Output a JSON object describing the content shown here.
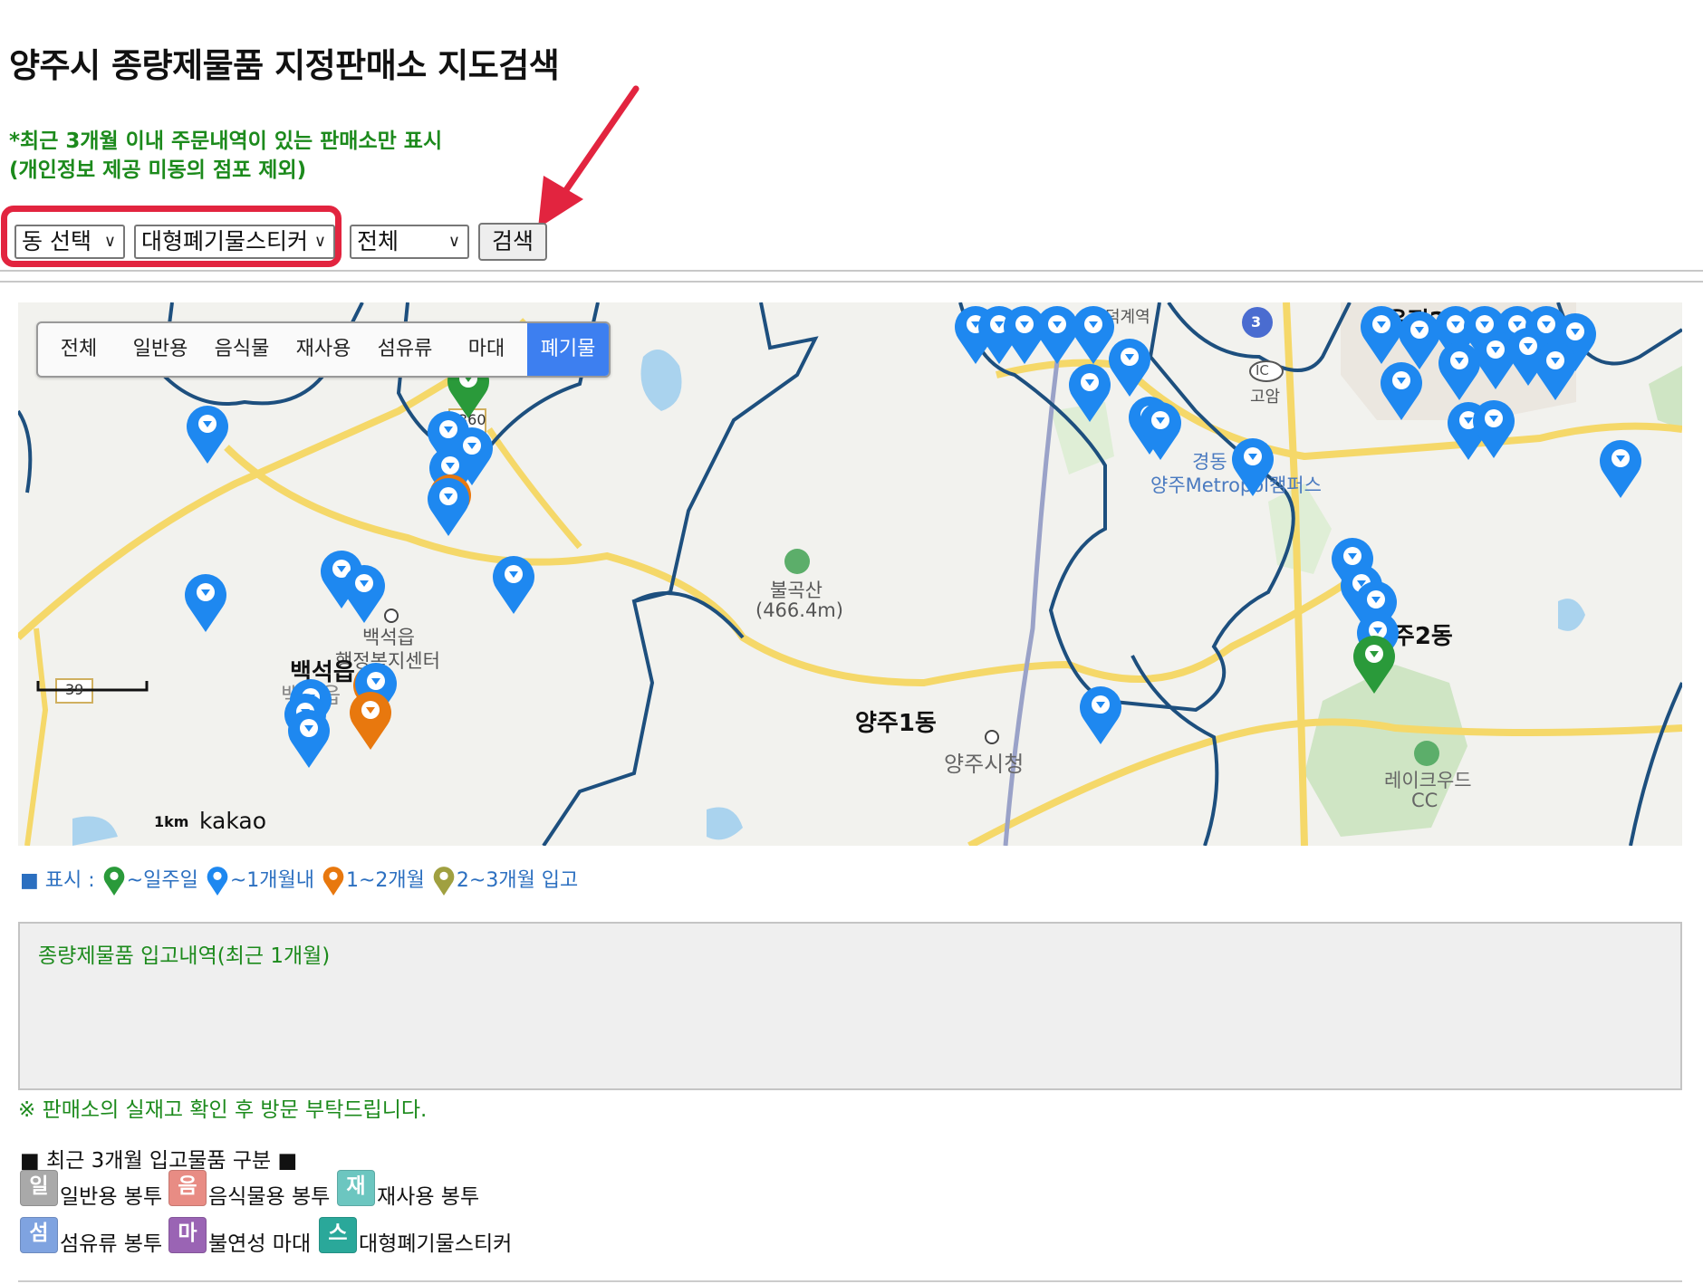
{
  "page_title": "양주시 종량제물품 지정판매소 지도검색",
  "notice_lines": [
    "*최근 3개월 이내 주문내역이 있는 판매소만 표시",
    "(개인정보 제공 미동의 점포 제외)"
  ],
  "search": {
    "dong_select": "동 선택",
    "item_select": "대형폐기물스티커",
    "type_select": "전체",
    "search_button": "검색"
  },
  "map": {
    "tabs": [
      {
        "label": "전체",
        "active": false
      },
      {
        "label": "일반용",
        "active": false
      },
      {
        "label": "음식물",
        "active": false
      },
      {
        "label": "재사용",
        "active": false
      },
      {
        "label": "섬유류",
        "active": false
      },
      {
        "label": "마대",
        "active": false
      },
      {
        "label": "폐기물",
        "active": true
      }
    ],
    "place_labels": {
      "baekseok_eup": "백석읍",
      "baekseok_office_1": "백석읍",
      "baekseok_office_2": "행정복지센터",
      "baekseok_gray": "백석읍",
      "bulgok_mountain": "불곡산",
      "bulgok_height": "(466.4m)",
      "yangju1": "양주1동",
      "yangju_cityhall": "양주시청",
      "yangju2": "양주2동",
      "okjeong2": "옥정2동",
      "gogam": "고암",
      "ic": "IC",
      "kyungdong_1": "경동",
      "kyungdong_2": "양주Metropol캠퍼스",
      "station": "덕계역",
      "lakewood_1": "레이크우드",
      "lakewood_2": "CC",
      "road_360": "360",
      "road_39": "39",
      "road_3": "3"
    },
    "scale_label": "1km",
    "provider": "kakao"
  },
  "legend": {
    "prefix": "■ 표시 :",
    "items": [
      "~일주일",
      "~1개월내",
      "1~2개월",
      "2~3개월 입고"
    ]
  },
  "history_title": "종량제물품 입고내역(최근 1개월)",
  "stock_note": "※ 판매소의 실재고 확인 후 방문 부탁드립니다.",
  "category_title": "■ 최근 3개월 입고물품 구분 ■",
  "categories": [
    {
      "badge": "일",
      "label": "일반용 봉투",
      "color": "#a9a9a9"
    },
    {
      "badge": "음",
      "label": "음식물용 봉투",
      "color": "#e88c84"
    },
    {
      "badge": "재",
      "label": "재사용 봉투",
      "color": "#6cc6c0"
    },
    {
      "badge": "섬",
      "label": "섬유류 봉투",
      "color": "#7fa3e0"
    },
    {
      "badge": "마",
      "label": "불연성 마대",
      "color": "#9a64b4"
    },
    {
      "badge": "스",
      "label": "대형폐기물스티커",
      "color": "#2aa89a"
    }
  ],
  "colors": {
    "pin_blue": "#1e88f0",
    "pin_orange": "#e8780e",
    "pin_green": "#2a9a3a",
    "pin_olive": "#a0a040",
    "notice_green": "#1c8a1c",
    "highlight_red": "#e2243f",
    "active_tab": "#3d7ff0"
  }
}
